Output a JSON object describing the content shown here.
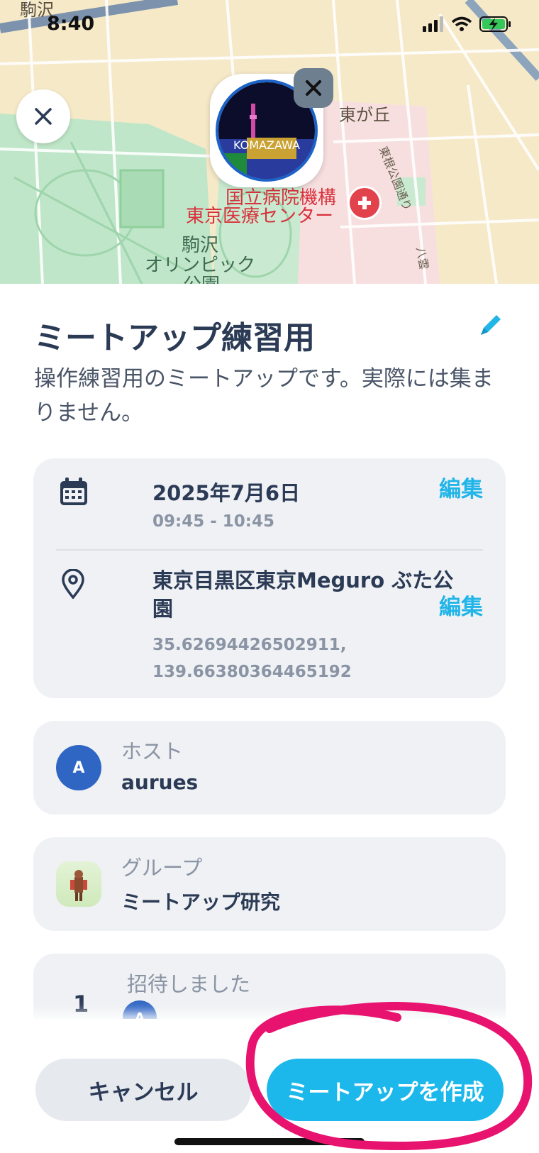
{
  "status_bar": {
    "time": "8:40"
  },
  "map": {
    "labels": {
      "top_left": "駒沢",
      "higashigaoka": "東が丘",
      "road": "東根公園通り",
      "hospital_line1": "国立病院機構",
      "hospital_line2": "東京医療センター",
      "park_line1": "駒沢",
      "park_line2": "オリンピック",
      "park_line3": "公園",
      "right_small": "八雲"
    },
    "photo_caption": "KOMAZAWA"
  },
  "meetup": {
    "title": "ミートアップ練習用",
    "description": "操作練習用のミートアップです。実際には集まりません。"
  },
  "schedule": {
    "date": "2025年7月6日",
    "time_range": "09:45 - 10:45",
    "edit_label": "編集"
  },
  "location": {
    "name": "東京目黒区東京Meguro ぶた公園",
    "lat": "35.62694426502911,",
    "lng": "139.66380364465192",
    "edit_label": "編集"
  },
  "host": {
    "label": "ホスト",
    "name": "aurues",
    "avatar_initial": "A"
  },
  "group": {
    "label": "グループ",
    "name": "ミートアップ研究"
  },
  "invite": {
    "count": "1",
    "label": "招待しました",
    "avatar_initial": "A"
  },
  "actions": {
    "cancel_label": "キャンセル",
    "create_label": "ミートアップを作成"
  },
  "colors": {
    "accent": "#1cb8ec",
    "title": "#2b3a55",
    "card": "#eff1f4",
    "annotation": "#e8136f"
  }
}
